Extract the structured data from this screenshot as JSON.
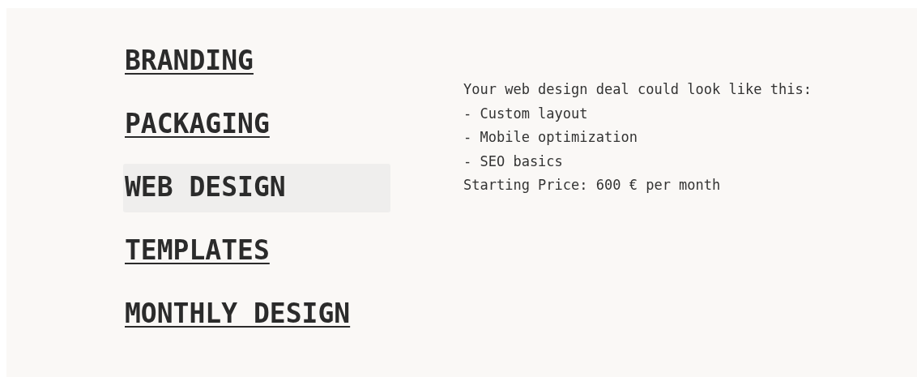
{
  "menu": [
    {
      "label": "BRANDING",
      "selected": false
    },
    {
      "label": "PACKAGING",
      "selected": false
    },
    {
      "label": "WEB DESIGN",
      "selected": true
    },
    {
      "label": "TEMPLATES",
      "selected": false
    },
    {
      "label": "MONTHLY DESIGN",
      "selected": false
    }
  ],
  "description": {
    "lines": [
      "Your web design deal could look like this:",
      "- Custom layout",
      "- Mobile optimization",
      "- SEO basics",
      "Starting Price: 600 € per month"
    ]
  }
}
